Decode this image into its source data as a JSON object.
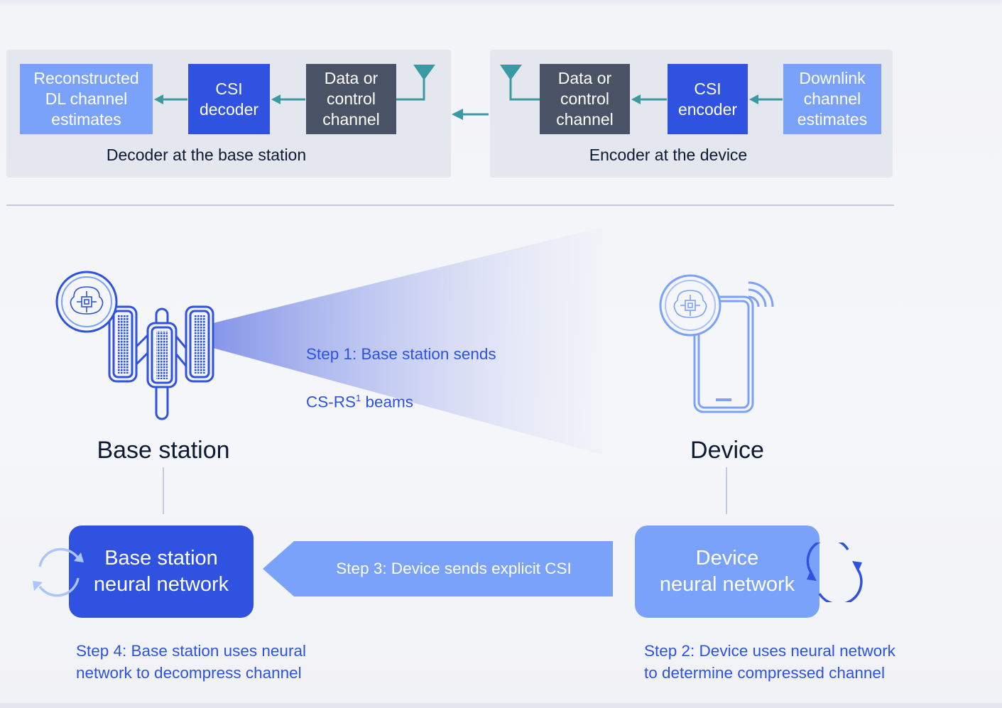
{
  "top_flow": {
    "decoder_panel": {
      "caption": "Decoder at the base station",
      "blocks": {
        "reconstructed": "Reconstructed\nDL channel\nestimates",
        "csi_decoder": "CSI\ndecoder",
        "channel": "Data or\ncontrol\nchannel"
      }
    },
    "encoder_panel": {
      "caption": "Encoder at the device",
      "blocks": {
        "channel": "Data or\ncontrol\nchannel",
        "csi_encoder": "CSI\nencoder",
        "downlink": "Downlink\nchannel\nestimates"
      }
    }
  },
  "base_station": {
    "label": "Base station",
    "nn_label": "Base station\nneural network"
  },
  "device": {
    "label": "Device",
    "nn_label": "Device\nneural network"
  },
  "steps": {
    "step1": "Step 1: Base station sends",
    "step1_line2_prefix": "CS-RS",
    "step1_superscript": "1",
    "step1_line2_suffix": " beams",
    "step2": "Step 2: Device uses neural network\nto determine compressed channel",
    "step3": "Step 3: Device sends explicit CSI",
    "step4": "Step 4: Base station uses neural\nnetwork to decompress channel"
  },
  "colors": {
    "light_blue": "#7ba2fb",
    "mid_blue": "#2f52e0",
    "dark_gray": "#4a5365",
    "teal_arrow": "#3a9aa3",
    "step_text": "#2a52e8"
  },
  "icons": [
    "brain-chip-icon",
    "antenna-icon",
    "smartphone-icon",
    "wifi-signal-icon",
    "refresh-cycle-icon"
  ]
}
